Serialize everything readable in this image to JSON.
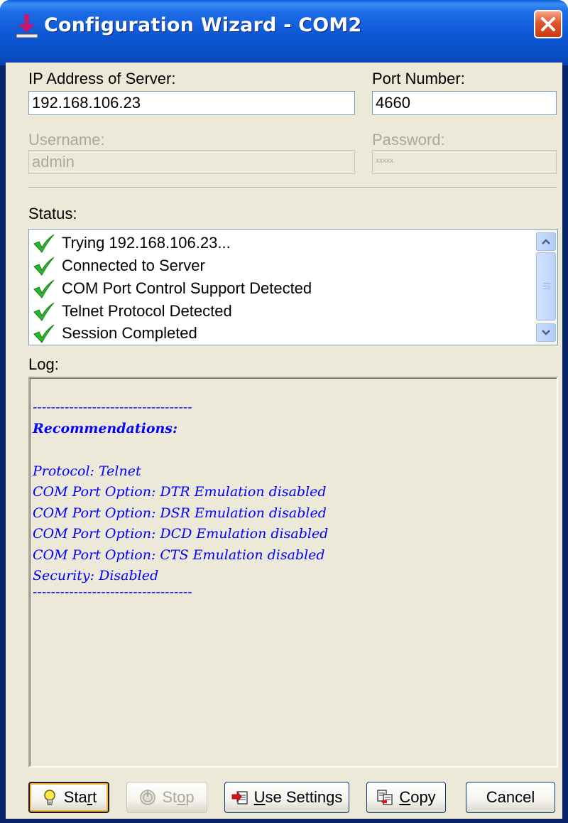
{
  "window": {
    "title": "Configuration Wizard - COM2"
  },
  "server": {
    "ip_label": "IP Address of Server:",
    "ip_value": "192.168.106.23",
    "port_label": "Port Number:",
    "port_value": "4660",
    "username_label": "Username:",
    "username_value": "admin",
    "password_label": "Password:",
    "password_value": "xxxxx"
  },
  "status": {
    "label": "Status:",
    "items": [
      "Trying 192.168.106.23...",
      "Connected to Server",
      "COM Port Control Support Detected",
      "Telnet Protocol Detected",
      "Session Completed"
    ]
  },
  "log": {
    "label": "Log:",
    "lines": [
      "-----------------------------------",
      "Recommendations:",
      "",
      "Protocol: Telnet",
      "COM Port Option: DTR Emulation disabled",
      "COM Port Option: DSR Emulation disabled",
      "COM Port Option: DCD Emulation disabled",
      "COM Port Option: CTS Emulation disabled",
      "Security: Disabled",
      "-----------------------------------"
    ]
  },
  "buttons": {
    "start": {
      "pre": "Sta",
      "accel": "r",
      "post": "t"
    },
    "stop": {
      "pre": "St",
      "accel": "o",
      "post": "p"
    },
    "use_settings": {
      "pre": "",
      "accel": "U",
      "post": "se Settings"
    },
    "copy": {
      "pre": "",
      "accel": "C",
      "post": "opy"
    },
    "cancel": "Cancel"
  },
  "colors": {
    "titlebar": "#0c56d4",
    "log_text": "#0000ff",
    "check": "#2bb52b",
    "dialog_bg": "#ece9d8"
  }
}
